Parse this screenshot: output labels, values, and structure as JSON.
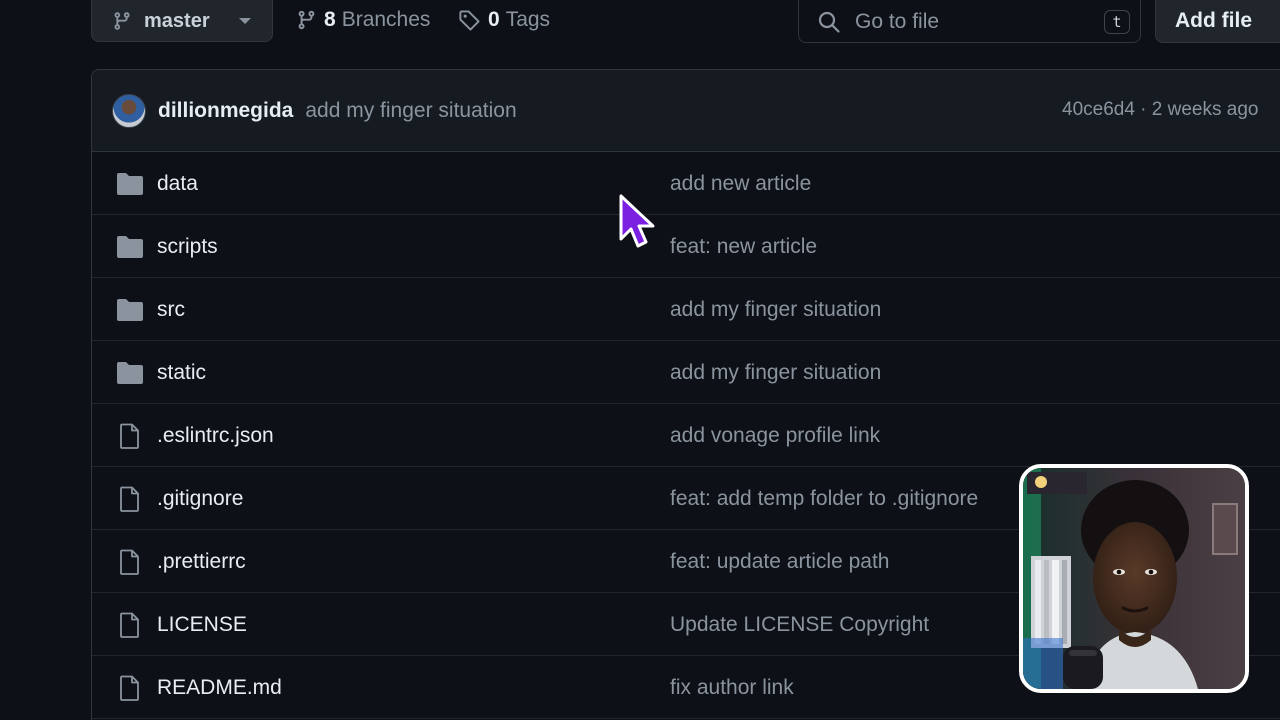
{
  "toolbar": {
    "branch_label": "master",
    "branches_count": "8",
    "branches_label": "Branches",
    "tags_count": "0",
    "tags_label": "Tags",
    "search_placeholder": "Go to file",
    "search_shortcut": "t",
    "add_file_label": "Add file"
  },
  "commit": {
    "author": "dillionmegida",
    "message": "add my finger situation",
    "sha_time": "40ce6d4 · 2 weeks ago"
  },
  "files": [
    {
      "name": "data",
      "type": "folder",
      "message": "add new article"
    },
    {
      "name": "scripts",
      "type": "folder",
      "message": "feat: new article"
    },
    {
      "name": "src",
      "type": "folder",
      "message": "add my finger situation"
    },
    {
      "name": "static",
      "type": "folder",
      "message": "add my finger situation"
    },
    {
      "name": ".eslintrc.json",
      "type": "file",
      "message": "add vonage profile link"
    },
    {
      "name": ".gitignore",
      "type": "file",
      "message": "feat: add temp folder to .gitignore"
    },
    {
      "name": ".prettierrc",
      "type": "file",
      "message": "feat: update article path"
    },
    {
      "name": "LICENSE",
      "type": "file",
      "message": "Update LICENSE Copyright"
    },
    {
      "name": "README.md",
      "type": "file",
      "message": "fix author link"
    }
  ],
  "icons": {
    "branch": "git-branch-icon",
    "tag": "tag-icon",
    "search": "search-icon",
    "caret": "triangle-down-icon",
    "folder": "folder-icon",
    "file": "file-icon",
    "cursor": "mouse-pointer-icon"
  },
  "colors": {
    "background": "#0d1117",
    "header_bg": "#161b22",
    "border": "#30363d",
    "text_primary": "#e6edf3",
    "text_muted": "#8b949e",
    "cursor_fill": "#7b1fe0"
  }
}
